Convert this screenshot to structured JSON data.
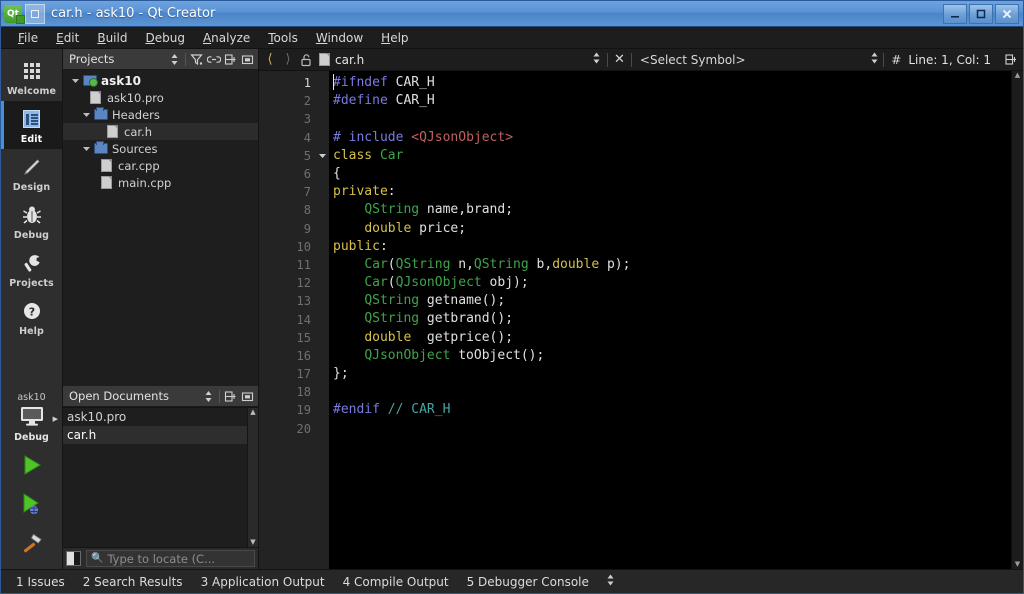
{
  "window": {
    "title": "car.h - ask10 - Qt Creator",
    "app_icon": "qt-logo-icon",
    "doc_icon": "document-icon",
    "minimize_label": "–",
    "maximize_label": "□",
    "close_label": "✕",
    "frame_color": "#2a5a9c",
    "titlebar_color": "#5b93d4"
  },
  "menubar": {
    "items": [
      {
        "label": "File",
        "mnemonic": "F"
      },
      {
        "label": "Edit",
        "mnemonic": "E"
      },
      {
        "label": "Build",
        "mnemonic": "B"
      },
      {
        "label": "Debug",
        "mnemonic": "D"
      },
      {
        "label": "Analyze",
        "mnemonic": "A"
      },
      {
        "label": "Tools",
        "mnemonic": "T"
      },
      {
        "label": "Window",
        "mnemonic": "W"
      },
      {
        "label": "Help",
        "mnemonic": "H"
      }
    ]
  },
  "modebar": {
    "modes": [
      {
        "label": "Welcome",
        "icon": "grid-icon",
        "active": false
      },
      {
        "label": "Edit",
        "icon": "document-edit-icon",
        "active": true
      },
      {
        "label": "Design",
        "icon": "pencil-icon",
        "active": false
      },
      {
        "label": "Debug",
        "icon": "bug-icon",
        "active": false
      },
      {
        "label": "Projects",
        "icon": "wrench-icon",
        "active": false
      },
      {
        "label": "Help",
        "icon": "question-icon",
        "active": false
      }
    ],
    "kit_selector": {
      "project": "ask10",
      "build_config": "Debug",
      "icon": "monitor-icon"
    },
    "actions": [
      {
        "name": "run-button",
        "icon": "green-play-icon"
      },
      {
        "name": "start-debugging-button",
        "icon": "green-play-bug-icon"
      },
      {
        "name": "build-button",
        "icon": "hammer-icon"
      }
    ]
  },
  "projects_panel": {
    "title": "Projects",
    "toolbar": [
      {
        "name": "view-selector",
        "icon": "up-down-arrows-icon"
      },
      {
        "name": "filter-button",
        "icon": "filter-icon"
      },
      {
        "name": "link-with-editor-button",
        "icon": "link-icon"
      },
      {
        "name": "split-button",
        "icon": "split-icon"
      },
      {
        "name": "close-panel-button",
        "icon": "close-pane-icon"
      }
    ],
    "tree": [
      {
        "label": "ask10",
        "icon": "project-icon",
        "depth": 0,
        "expanded": true,
        "bold": true,
        "selected": false
      },
      {
        "label": "ask10.pro",
        "icon": "file-icon",
        "depth": 1,
        "expanded": null,
        "bold": false,
        "selected": false
      },
      {
        "label": "Headers",
        "icon": "folder-icon",
        "depth": 1,
        "expanded": true,
        "bold": false,
        "selected": false
      },
      {
        "label": "car.h",
        "icon": "file-icon",
        "depth": 2,
        "expanded": null,
        "bold": false,
        "selected": true
      },
      {
        "label": "Sources",
        "icon": "folder-icon",
        "depth": 1,
        "expanded": true,
        "bold": false,
        "selected": false
      },
      {
        "label": "car.cpp",
        "icon": "file-icon",
        "depth": 2,
        "expanded": null,
        "bold": false,
        "selected": false
      },
      {
        "label": "main.cpp",
        "icon": "file-icon",
        "depth": 2,
        "expanded": null,
        "bold": false,
        "selected": false
      }
    ]
  },
  "open_documents": {
    "title": "Open Documents",
    "toolbar": [
      {
        "name": "sort-selector",
        "icon": "up-down-arrows-icon"
      },
      {
        "name": "split-button",
        "icon": "split-icon"
      },
      {
        "name": "close-pane-button",
        "icon": "close-pane-icon"
      }
    ],
    "items": [
      {
        "label": "ask10.pro",
        "selected": false
      },
      {
        "label": "car.h",
        "selected": true
      }
    ]
  },
  "locator": {
    "toggle_icon": "sidebar-toggle-icon",
    "search_icon": "magnifier-icon",
    "placeholder": "Type to locate (C..."
  },
  "editor_toolbar": {
    "back_icon": "chevron-left-icon",
    "forward_icon": "chevron-right-icon",
    "lock_icon": "unlocked-icon",
    "file_icon": "document-icon",
    "filename": "car.h",
    "file_dropdown_icon": "up-down-arrows-icon",
    "close_icon": "close-icon",
    "symbol_selector": "<Select Symbol>",
    "symbol_dropdown_icon": "up-down-arrows-icon",
    "line_col_icon": "hash-icon",
    "line_col": "Line: 1, Col: 1",
    "split_icon": "split-icon"
  },
  "editor": {
    "gutter_bg": "#232323",
    "background": "#000000",
    "current_line": 1,
    "fold_marker_line": 5,
    "total_lines": 20,
    "lines": [
      {
        "n": 1,
        "tokens": [
          {
            "t": "pre",
            "s": "#ifndef"
          },
          {
            "t": "pln",
            "s": " CAR_H"
          }
        ]
      },
      {
        "n": 2,
        "tokens": [
          {
            "t": "pre",
            "s": "#define"
          },
          {
            "t": "pln",
            "s": " CAR_H"
          }
        ]
      },
      {
        "n": 3,
        "tokens": []
      },
      {
        "n": 4,
        "tokens": [
          {
            "t": "pre",
            "s": "# include "
          },
          {
            "t": "str",
            "s": "<QJsonObject>"
          }
        ]
      },
      {
        "n": 5,
        "tokens": [
          {
            "t": "kw",
            "s": "class "
          },
          {
            "t": "type",
            "s": "Car"
          }
        ]
      },
      {
        "n": 6,
        "tokens": [
          {
            "t": "pln",
            "s": "{"
          }
        ]
      },
      {
        "n": 7,
        "tokens": [
          {
            "t": "kw",
            "s": "private"
          },
          {
            "t": "pln",
            "s": ":"
          }
        ]
      },
      {
        "n": 8,
        "tokens": [
          {
            "t": "pln",
            "s": "    "
          },
          {
            "t": "type",
            "s": "QString"
          },
          {
            "t": "pln",
            "s": " name,brand;"
          }
        ]
      },
      {
        "n": 9,
        "tokens": [
          {
            "t": "pln",
            "s": "    "
          },
          {
            "t": "kw",
            "s": "double"
          },
          {
            "t": "pln",
            "s": " price;"
          }
        ]
      },
      {
        "n": 10,
        "tokens": [
          {
            "t": "kw",
            "s": "public"
          },
          {
            "t": "pln",
            "s": ":"
          }
        ]
      },
      {
        "n": 11,
        "tokens": [
          {
            "t": "pln",
            "s": "    "
          },
          {
            "t": "type",
            "s": "Car"
          },
          {
            "t": "pln",
            "s": "("
          },
          {
            "t": "type",
            "s": "QString"
          },
          {
            "t": "pln",
            "s": " n,"
          },
          {
            "t": "type",
            "s": "QString"
          },
          {
            "t": "pln",
            "s": " b,"
          },
          {
            "t": "kw",
            "s": "double"
          },
          {
            "t": "pln",
            "s": " p);"
          }
        ]
      },
      {
        "n": 12,
        "tokens": [
          {
            "t": "pln",
            "s": "    "
          },
          {
            "t": "type",
            "s": "Car"
          },
          {
            "t": "pln",
            "s": "("
          },
          {
            "t": "type",
            "s": "QJsonObject"
          },
          {
            "t": "pln",
            "s": " obj);"
          }
        ]
      },
      {
        "n": 13,
        "tokens": [
          {
            "t": "pln",
            "s": "    "
          },
          {
            "t": "type",
            "s": "QString"
          },
          {
            "t": "pln",
            "s": " getname();"
          }
        ]
      },
      {
        "n": 14,
        "tokens": [
          {
            "t": "pln",
            "s": "    "
          },
          {
            "t": "type",
            "s": "QString"
          },
          {
            "t": "pln",
            "s": " getbrand();"
          }
        ]
      },
      {
        "n": 15,
        "tokens": [
          {
            "t": "pln",
            "s": "    "
          },
          {
            "t": "kw",
            "s": "double"
          },
          {
            "t": "pln",
            "s": "  getprice();"
          }
        ]
      },
      {
        "n": 16,
        "tokens": [
          {
            "t": "pln",
            "s": "    "
          },
          {
            "t": "type",
            "s": "QJsonObject"
          },
          {
            "t": "pln",
            "s": " toObject();"
          }
        ]
      },
      {
        "n": 17,
        "tokens": [
          {
            "t": "pln",
            "s": "};"
          }
        ]
      },
      {
        "n": 18,
        "tokens": []
      },
      {
        "n": 19,
        "tokens": [
          {
            "t": "pre",
            "s": "#endif"
          },
          {
            "t": "cmt",
            "s": " // CAR_H"
          }
        ]
      },
      {
        "n": 20,
        "tokens": []
      }
    ],
    "colors": {
      "preprocessor": "#7a7ae0",
      "keyword": "#d6c04a",
      "type": "#3fa34a",
      "string": "#c06060",
      "comment": "#46a5a5",
      "plain": "#e0e0e0"
    }
  },
  "output_bar": {
    "items": [
      {
        "label": "1 Issues"
      },
      {
        "label": "2 Search Results"
      },
      {
        "label": "3 Application Output"
      },
      {
        "label": "4 Compile Output"
      },
      {
        "label": "5 Debugger Console"
      }
    ],
    "expand_icon": "up-down-arrows-icon"
  }
}
